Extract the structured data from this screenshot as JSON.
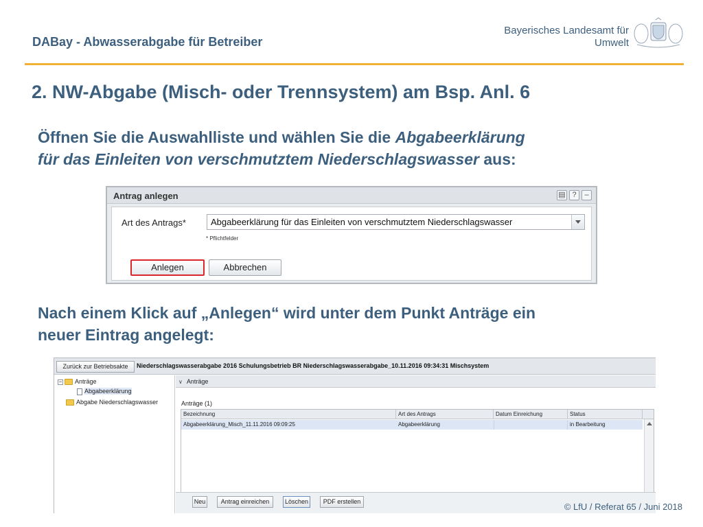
{
  "header": {
    "app_title": "DABay - Abwasserabgabe für Betreiber",
    "org_line1": "Bayerisches Landesamt für",
    "org_line2": "Umwelt"
  },
  "slide": {
    "title": "2. NW-Abgabe (Misch- oder Trennsystem) am Bsp. Anl. 6",
    "para1_prefix": "Öffnen Sie die Auswahlliste und wählen Sie die ",
    "para1_em1": "Abgabeerklärung",
    "para1_em2": "für das Einleiten von verschmutztem Niederschlagswasser",
    "para1_suffix": " aus:",
    "para2_line1": "Nach einem Klick auf „Anlegen“ wird unter dem Punkt Anträge ein",
    "para2_line2": "neuer Eintrag angelegt:"
  },
  "dialog": {
    "title": "Antrag anlegen",
    "field_label": "Art des Antrags*",
    "select_value": "Abgabeerklärung für das Einleiten von verschmutztem Niederschlagswasser",
    "required_note": "* Pflichtfelder",
    "create_label": "Anlegen",
    "cancel_label": "Abbrechen",
    "tool_note": "▤",
    "tool_help": "?",
    "tool_min": "–"
  },
  "app": {
    "back_label": "Zurück zur Betriebsakte",
    "window_title": "Niederschlagswasserabgabe 2016 Schulungsbetrieb BR Niederschlagswasserabgabe_10.11.2016 09:34:31 Mischsystem",
    "tree": {
      "node1": "Anträge",
      "node1_child": "Abgabeerklärung",
      "node2": "Abgabe Niederschlagswasser",
      "toggle": "−"
    },
    "panel_title": "Anträge",
    "grid_caption": "Anträge (1)",
    "columns": {
      "bezeichnung": "Bezeichnung",
      "art": "Art des Antrags",
      "datum": "Datum Einreichung",
      "status": "Status"
    },
    "rows": [
      {
        "bezeichnung": "Abgabeerklärung_Misch_11.11.2016 09:09:25",
        "art": "Abgabeerklärung",
        "datum": "",
        "status": "in Bearbeitung"
      }
    ],
    "buttons": {
      "neu": "Neu",
      "einreichen": "Antrag einreichen",
      "loeschen": "Löschen",
      "pdf": "PDF erstellen"
    }
  },
  "footer": {
    "text": "© LfU / Referat 65 / Juni 2018"
  },
  "colors": {
    "title_blue": "#3d5f7e",
    "accent_rule": "#f0b134",
    "highlight_red": "#d9262b",
    "selected_row": "#dce6f4"
  }
}
